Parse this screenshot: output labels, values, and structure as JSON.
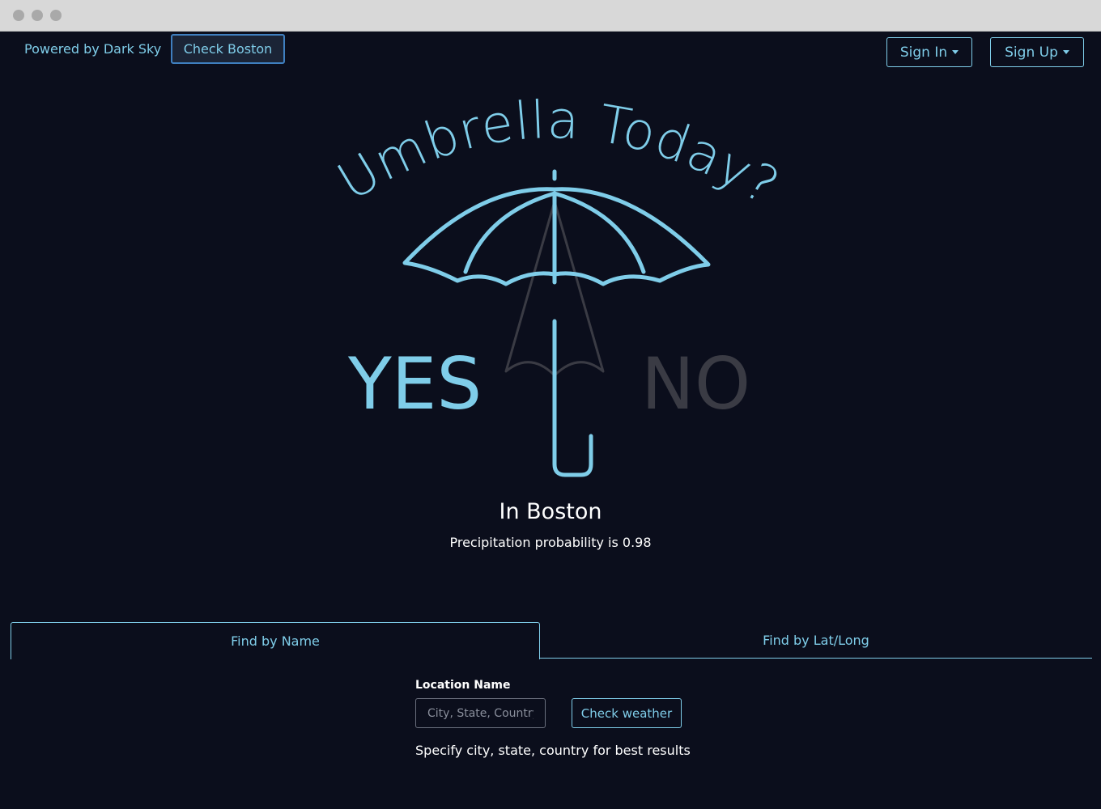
{
  "header": {
    "powered_by": "Powered by Dark Sky",
    "check_boston": "Check Boston",
    "sign_in": "Sign In",
    "sign_up": "Sign Up"
  },
  "logo": {
    "title": "Umbrella Today?",
    "yes": "YES",
    "no": "NO",
    "accent_color": "#7fcde9",
    "muted_color": "#3a3b44"
  },
  "result": {
    "city": "In Boston",
    "precip": "Precipitation probability is 0.98"
  },
  "tabs": [
    {
      "label": "Find by Name",
      "active": true
    },
    {
      "label": "Find by Lat/Long",
      "active": false
    }
  ],
  "form": {
    "location_label": "Location Name",
    "placeholder": "City, State, Country",
    "value": "",
    "submit": "Check weather",
    "hint": "Specify city, state, country for best results"
  }
}
